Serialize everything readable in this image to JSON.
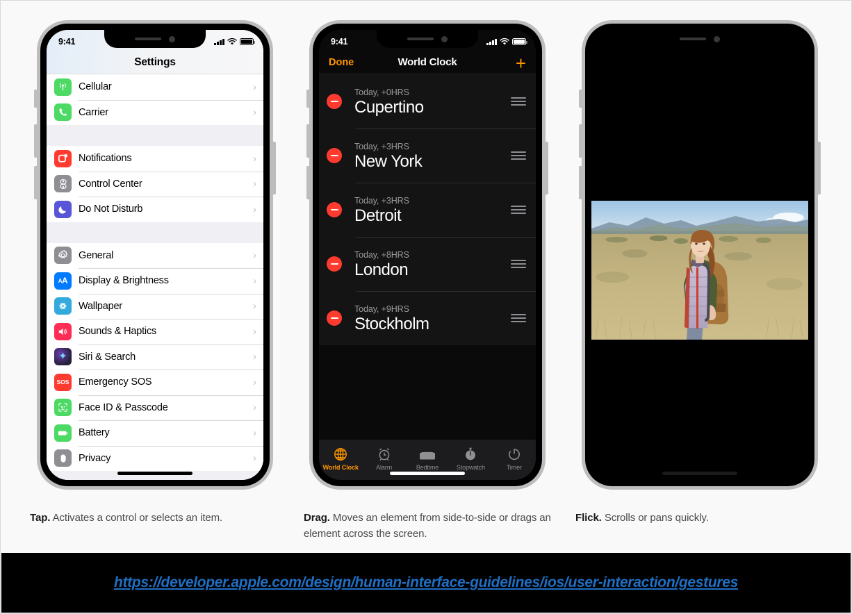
{
  "page": {
    "background_color": "#f9f9f9",
    "footer_background": "#000000",
    "link_color": "#1f6fc4"
  },
  "phone_tap": {
    "status_bar": {
      "time": "9:41",
      "cellular_icon": "signal-bars-icon",
      "wifi_icon": "wifi-icon",
      "battery_icon": "battery-icon"
    },
    "title": "Settings",
    "groups": [
      {
        "rows": [
          {
            "label": "Cellular",
            "icon": "cellular-icon",
            "icon_color": "#4cd964",
            "chevron": "›"
          },
          {
            "label": "Carrier",
            "icon": "phone-icon",
            "icon_color": "#4cd964",
            "chevron": "›"
          }
        ]
      },
      {
        "rows": [
          {
            "label": "Notifications",
            "icon": "notifications-icon",
            "icon_color": "#ff3b30",
            "chevron": "›"
          },
          {
            "label": "Control Center",
            "icon": "control-center-icon",
            "icon_color": "#8e8e93",
            "chevron": "›"
          },
          {
            "label": "Do Not Disturb",
            "icon": "moon-icon",
            "icon_color": "#5856d6",
            "chevron": "›"
          }
        ]
      },
      {
        "rows": [
          {
            "label": "General",
            "icon": "gear-icon",
            "icon_color": "#8e8e93",
            "chevron": "›"
          },
          {
            "label": "Display & Brightness",
            "icon": "display-brightness-icon",
            "icon_color": "#007aff",
            "chevron": "›"
          },
          {
            "label": "Wallpaper",
            "icon": "wallpaper-icon",
            "icon_color": "#34aadc",
            "chevron": "›"
          },
          {
            "label": "Sounds & Haptics",
            "icon": "speaker-icon",
            "icon_color": "#ff2d55",
            "chevron": "›"
          },
          {
            "label": "Siri & Search",
            "icon": "siri-icon",
            "icon_color": "#2c2c3e",
            "chevron": "›"
          },
          {
            "label": "Emergency SOS",
            "icon": "sos-icon",
            "icon_color": "#ff3b30",
            "chevron": "›"
          },
          {
            "label": "Face ID & Passcode",
            "icon": "face-id-icon",
            "icon_color": "#4cd964",
            "chevron": "›"
          },
          {
            "label": "Battery",
            "icon": "battery-settings-icon",
            "icon_color": "#4cd964",
            "chevron": "›"
          },
          {
            "label": "Privacy",
            "icon": "hand-icon",
            "icon_color": "#8e8e93",
            "chevron": "›"
          }
        ]
      }
    ]
  },
  "phone_drag": {
    "status_bar": {
      "time": "9:41",
      "cellular_icon": "signal-bars-icon",
      "wifi_icon": "wifi-icon",
      "battery_icon": "battery-icon"
    },
    "nav": {
      "left_button": "Done",
      "title": "World Clock",
      "right_button": "+",
      "accent_color": "#ff9500"
    },
    "clocks": [
      {
        "offset": "Today, +0HRS",
        "city": "Cupertino"
      },
      {
        "offset": "Today, +3HRS",
        "city": "New York"
      },
      {
        "offset": "Today, +3HRS",
        "city": "Detroit"
      },
      {
        "offset": "Today, +8HRS",
        "city": "London"
      },
      {
        "offset": "Today, +9HRS",
        "city": "Stockholm"
      }
    ],
    "tabs": [
      {
        "label": "World Clock",
        "icon": "globe-icon",
        "active": true
      },
      {
        "label": "Alarm",
        "icon": "alarm-clock-icon",
        "active": false
      },
      {
        "label": "Bedtime",
        "icon": "bed-icon",
        "active": false
      },
      {
        "label": "Stopwatch",
        "icon": "stopwatch-icon",
        "active": false
      },
      {
        "label": "Timer",
        "icon": "timer-icon",
        "active": false
      }
    ]
  },
  "phone_flick": {
    "photo_alt": "Photo of a person with a backpack standing in a dry grass field with mountains in the background"
  },
  "captions": [
    {
      "term": "Tap.",
      "text": " Activates a control or selects an item."
    },
    {
      "term": "Drag.",
      "text": " Moves an element from side-to-side or drags an element across the screen."
    },
    {
      "term": "Flick.",
      "text": " Scrolls or pans quickly."
    }
  ],
  "footer": {
    "url": "https://developer.apple.com/design/human-interface-guidelines/ios/user-interaction/gestures"
  }
}
